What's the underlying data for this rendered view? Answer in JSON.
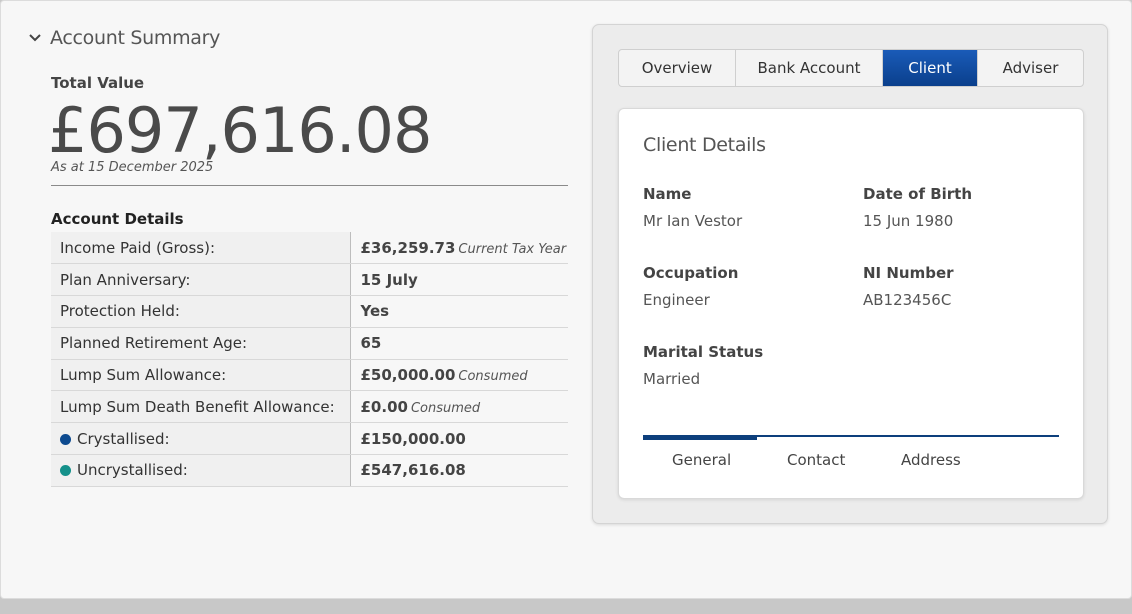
{
  "account_summary": {
    "header": "Account Summary",
    "total_label": "Total Value",
    "total_value": "£697,616.08",
    "as_at": "As at 15 December 2025",
    "details_title": "Account Details",
    "rows": [
      {
        "label": "Income Paid (Gross):",
        "value": "£36,259.73",
        "note": "Current Tax Year"
      },
      {
        "label": "Plan Anniversary:",
        "value": "15 July",
        "note": ""
      },
      {
        "label": "Protection Held:",
        "value": "Yes",
        "note": ""
      },
      {
        "label": "Planned Retirement Age:",
        "value": "65",
        "note": ""
      },
      {
        "label": "Lump Sum Allowance:",
        "value": "£50,000.00",
        "note": "Consumed"
      },
      {
        "label": "Lump Sum Death Benefit Allowance:",
        "value": "£0.00",
        "note": "Consumed"
      },
      {
        "label": "Crystallised:",
        "value": "£150,000.00",
        "note": "",
        "dot_color": "#0d4a8f"
      },
      {
        "label": "Uncrystallised:",
        "value": "£547,616.08",
        "note": "",
        "dot_color": "#14908a"
      }
    ]
  },
  "tabs": [
    "Overview",
    "Bank Account",
    "Client",
    "Adviser"
  ],
  "active_tab": "Client",
  "client": {
    "title": "Client Details",
    "name_label": "Name",
    "name": "Mr Ian Vestor",
    "dob_label": "Date of Birth",
    "dob": "15 Jun 1980",
    "occupation_label": "Occupation",
    "occupation": "Engineer",
    "ni_label": "NI Number",
    "ni": "AB123456C",
    "marital_label": "Marital Status",
    "marital": "Married",
    "subtabs": [
      "General",
      "Contact",
      "Address"
    ],
    "active_subtab": "General"
  },
  "colors": {
    "accent": "#0a3f8c",
    "crystallised": "#0d4a8f",
    "uncrystallised": "#14908a"
  }
}
